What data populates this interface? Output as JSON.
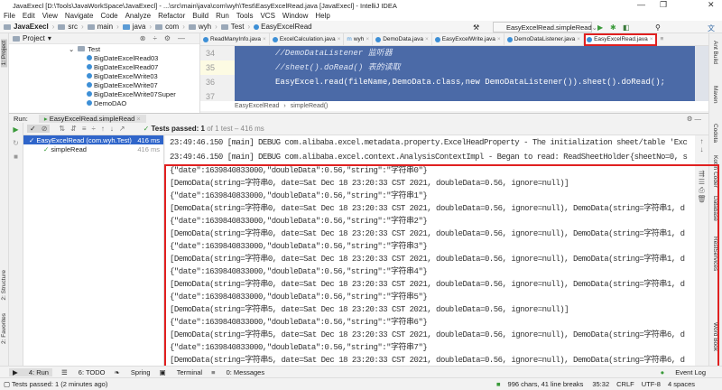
{
  "window": {
    "title": "JavaExecl [D:\\Tools\\JavaWorkSpace\\JavaExecl] - ...\\src\\main\\java\\com\\wyh\\Test\\EasyExcelRead.java [JavaExecl] - IntelliJ IDEA",
    "minimize": "—",
    "maximize": "❐",
    "close": "✕"
  },
  "menu": [
    "File",
    "Edit",
    "View",
    "Navigate",
    "Code",
    "Analyze",
    "Refactor",
    "Build",
    "Run",
    "Tools",
    "VCS",
    "Window",
    "Help"
  ],
  "breadcrumb": [
    "JavaExecl",
    "src",
    "main",
    "java",
    "com",
    "wyh",
    "Test",
    "EasyExcelRead"
  ],
  "run_config": "EasyExcelRead.simpleRead",
  "project": {
    "title": "Project",
    "items": [
      {
        "label": "Test",
        "kind": "folder"
      },
      {
        "label": "BigDateExcelRead03",
        "kind": "class"
      },
      {
        "label": "BigDateExcelRead07",
        "kind": "class"
      },
      {
        "label": "BigDateExcelWrite03",
        "kind": "class"
      },
      {
        "label": "BigDateExcelWrite07",
        "kind": "class"
      },
      {
        "label": "BigDateExcelWrite07Super",
        "kind": "class"
      },
      {
        "label": "DemoDAO",
        "kind": "class"
      }
    ]
  },
  "editor": {
    "tabs": [
      "ReadManyInfo.java",
      "ExcelCalculation.java",
      "wyh",
      "DemoData.java",
      "EasyExcelWrite.java",
      "DemoDataListener.java",
      "EasyExcelRead.java"
    ],
    "active_tab": "EasyExcelRead.java",
    "line_numbers": [
      "34",
      "35",
      "36",
      "37"
    ],
    "lines": [
      "//DemoDataListener 监听器",
      "//sheet().doRead() 表的读取",
      "EasyExcel.read(fileName,DemoData.class,new DemoDataListener()).sheet().doRead();",
      ""
    ],
    "crumb": [
      "EasyExcelRead",
      "simpleRead()"
    ]
  },
  "run": {
    "label": "Run:",
    "tab": "EasyExcelRead.simpleRead",
    "status": "Tests passed:",
    "status_count": "1",
    "status_rest": "of 1 test – 416 ms",
    "tree": [
      {
        "label": "EasyExcelRead (com.wyh.Test)",
        "time": "416 ms"
      },
      {
        "label": "simpleRead",
        "time": "416 ms"
      }
    ],
    "console": [
      "23:49:46.150 [main] DEBUG com.alibaba.excel.metadata.property.ExcelHeadProperty - The initialization sheet/table 'Exc",
      "23:49:46.150 [main] DEBUG com.alibaba.excel.context.AnalysisContextImpl - Began to read: ReadSheetHolder{sheetNo=0, s",
      "{\"date\":1639840833000,\"doubleData\":0.56,\"string\":\"字符串0\"}",
      "[DemoData(string=字符串0, date=Sat Dec 18 23:20:33 CST 2021, doubleData=0.56, ignore=null)]",
      "{\"date\":1639840833000,\"doubleData\":0.56,\"string\":\"字符串1\"}",
      "[DemoData(string=字符串0, date=Sat Dec 18 23:20:33 CST 2021, doubleData=0.56, ignore=null), DemoData(string=字符串1, d",
      "{\"date\":1639840833000,\"doubleData\":0.56,\"string\":\"字符串2\"}",
      "[DemoData(string=字符串0, date=Sat Dec 18 23:20:33 CST 2021, doubleData=0.56, ignore=null), DemoData(string=字符串1, d",
      "{\"date\":1639840833000,\"doubleData\":0.56,\"string\":\"字符串3\"}",
      "[DemoData(string=字符串0, date=Sat Dec 18 23:20:33 CST 2021, doubleData=0.56, ignore=null), DemoData(string=字符串1, d",
      "{\"date\":1639840833000,\"doubleData\":0.56,\"string\":\"字符串4\"}",
      "[DemoData(string=字符串0, date=Sat Dec 18 23:20:33 CST 2021, doubleData=0.56, ignore=null), DemoData(string=字符串1, d",
      "{\"date\":1639840833000,\"doubleData\":0.56,\"string\":\"字符串5\"}",
      "[DemoData(string=字符串5, date=Sat Dec 18 23:20:33 CST 2021, doubleData=0.56, ignore=null)]",
      "{\"date\":1639840833000,\"doubleData\":0.56,\"string\":\"字符串6\"}",
      "[DemoData(string=字符串5, date=Sat Dec 18 23:20:33 CST 2021, doubleData=0.56, ignore=null), DemoData(string=字符串6, d",
      "{\"date\":1639840833000,\"doubleData\":0.56,\"string\":\"字符串7\"}",
      "[DemoData(string=字符串5, date=Sat Dec 18 23:20:33 CST 2021, doubleData=0.56, ignore=null), DemoData(string=字符串6, d"
    ]
  },
  "left_tools": [
    "1: Project",
    "2: Structure",
    "2: Favorites"
  ],
  "right_tools": [
    "Ant Build",
    "Maven",
    "Codota",
    "Kotlin Coder",
    "Database",
    "RestServices",
    "Word Book"
  ],
  "bottom_tabs": [
    "4: Run",
    "6: TODO",
    "Spring",
    "Terminal",
    "0: Messages"
  ],
  "event_log": "Event Log",
  "statusbar": {
    "message": "Tests passed: 1 (2 minutes ago)",
    "chars": "996 chars, 41 line breaks",
    "position": "35:32",
    "line_sep": "CRLF",
    "encoding": "UTF-8",
    "indent": "4 spaces"
  }
}
